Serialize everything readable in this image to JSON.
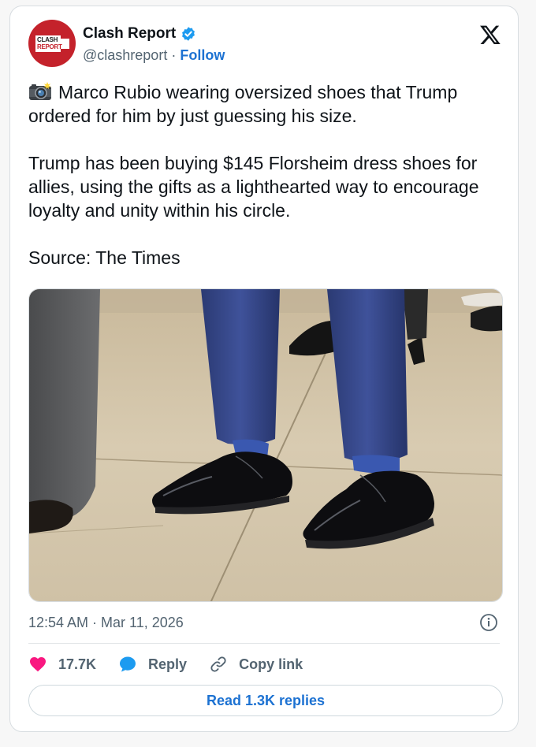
{
  "account": {
    "name": "Clash Report",
    "handle": "@clashreport",
    "separator": " · ",
    "follow_label": "Follow",
    "avatar_text_top": "CLASH",
    "avatar_text_bottom": "REPORT",
    "verified": true
  },
  "tweet": {
    "paragraph1": "Marco Rubio wearing oversized shoes that Trump ordered for him by just guessing his size.",
    "paragraph2": "Trump has been buying $145 Florsheim dress shoes for allies, using the gifts as a lighthearted way to encourage loyalty and unity within his circle.",
    "paragraph3": "Source: The Times",
    "emoji": "camera-with-flash-icon"
  },
  "meta": {
    "timestamp": "12:54 AM · Mar 11, 2026"
  },
  "actions": {
    "like_count": "17.7K",
    "reply_label": "Reply",
    "copy_label": "Copy link"
  },
  "read_replies_label": "Read 1.3K replies",
  "colors": {
    "brand_red": "#c4222b",
    "link_blue": "#1d72d2",
    "verified_blue": "#1d9bf0",
    "like_pink": "#f91880",
    "muted_text": "#536471"
  },
  "icons": [
    "verified-badge-icon",
    "x-logo-icon",
    "camera-with-flash-icon",
    "info-icon",
    "heart-icon",
    "speech-bubble-icon",
    "link-icon"
  ]
}
